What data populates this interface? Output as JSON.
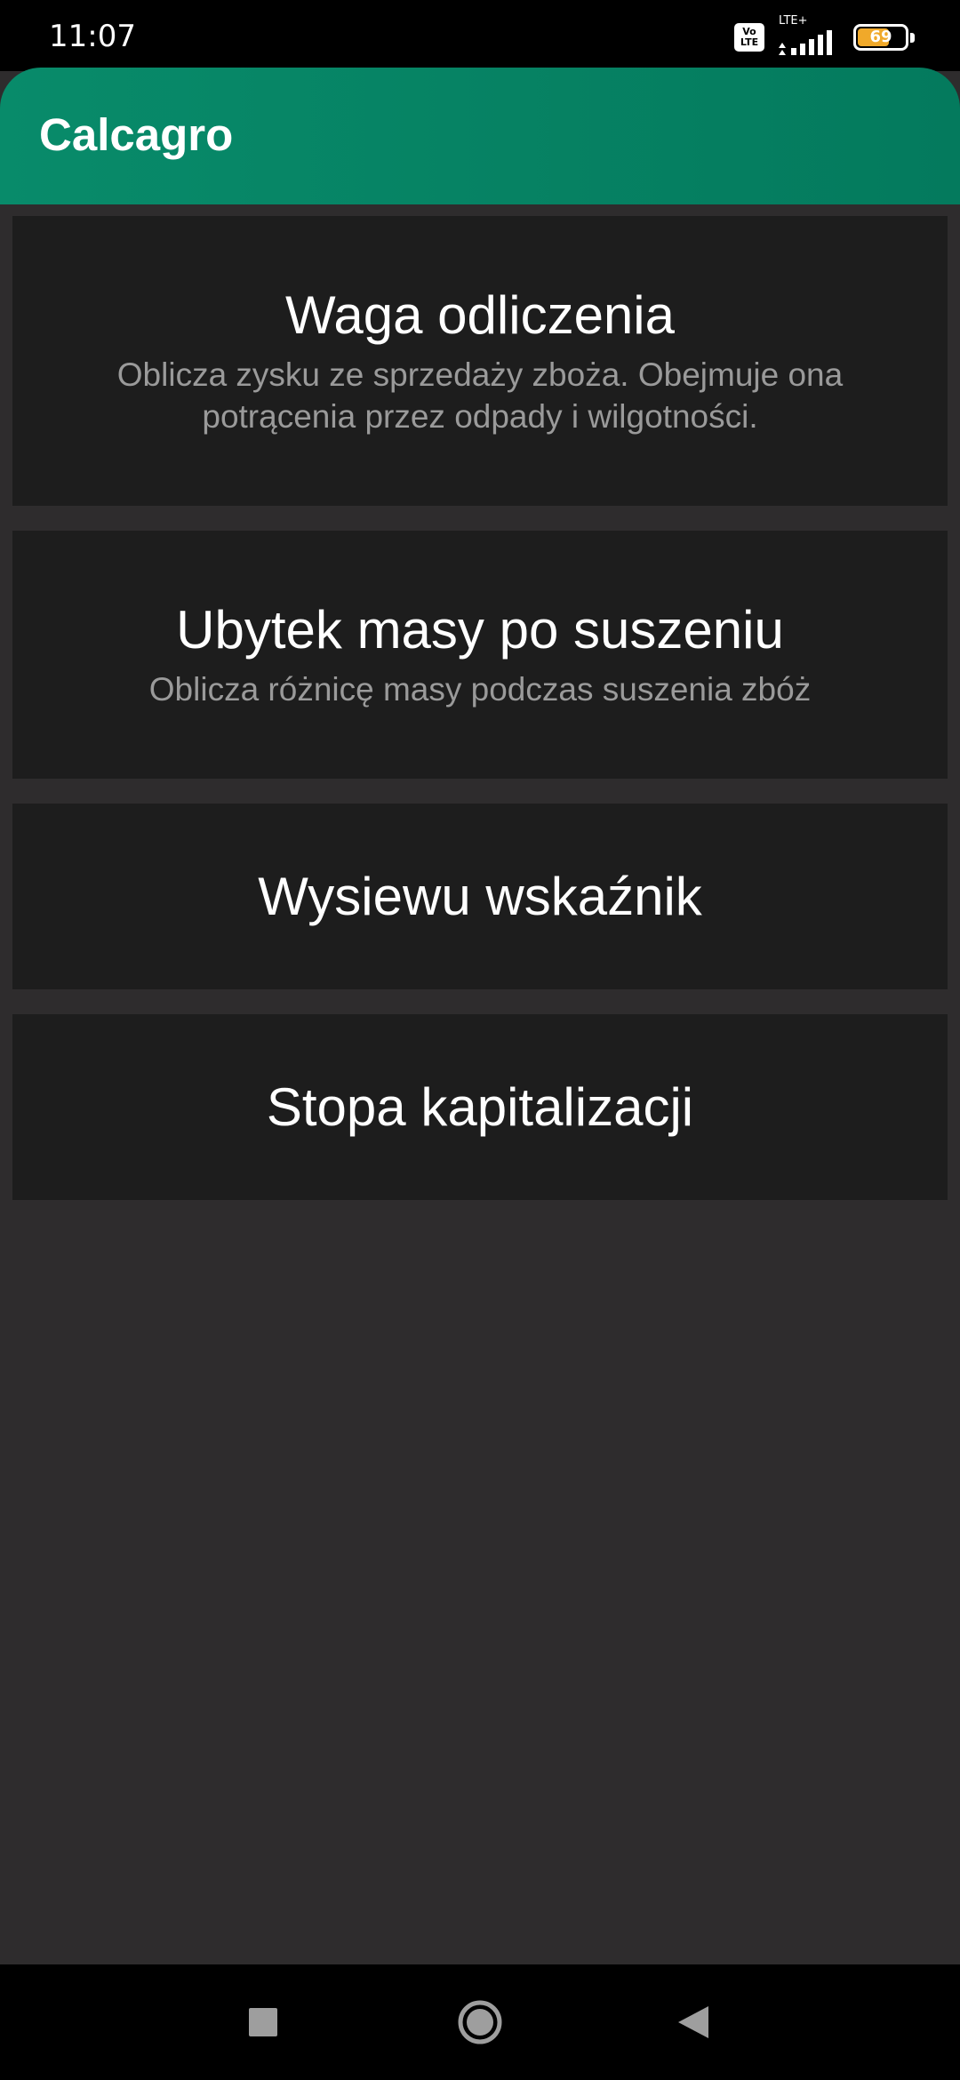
{
  "status_bar": {
    "time": "11:07",
    "volte_top": "Vo",
    "volte_bottom": "LTE",
    "network": "LTE+",
    "battery": "69",
    "battery_level_percent": 69,
    "battery_color": "#f0a92a"
  },
  "app_bar": {
    "title": "Calcagro",
    "color": "#047a5d"
  },
  "menu": {
    "items": [
      {
        "title": "Waga odliczenia",
        "description": "Oblicza zysku ze sprzedaży zboża. Obejmuje ona potrącenia przez odpady i wilgotności."
      },
      {
        "title": "Ubytek masy po suszeniu",
        "description": "Oblicza różnicę masy podczas suszenia zbóż"
      },
      {
        "title": "Wysiewu wskaźnik"
      },
      {
        "title": "Stopa kapitalizacji"
      }
    ]
  },
  "nav_bar": {
    "recents_icon": "square-icon",
    "home_icon": "circle-icon",
    "back_icon": "triangle-back-icon"
  }
}
